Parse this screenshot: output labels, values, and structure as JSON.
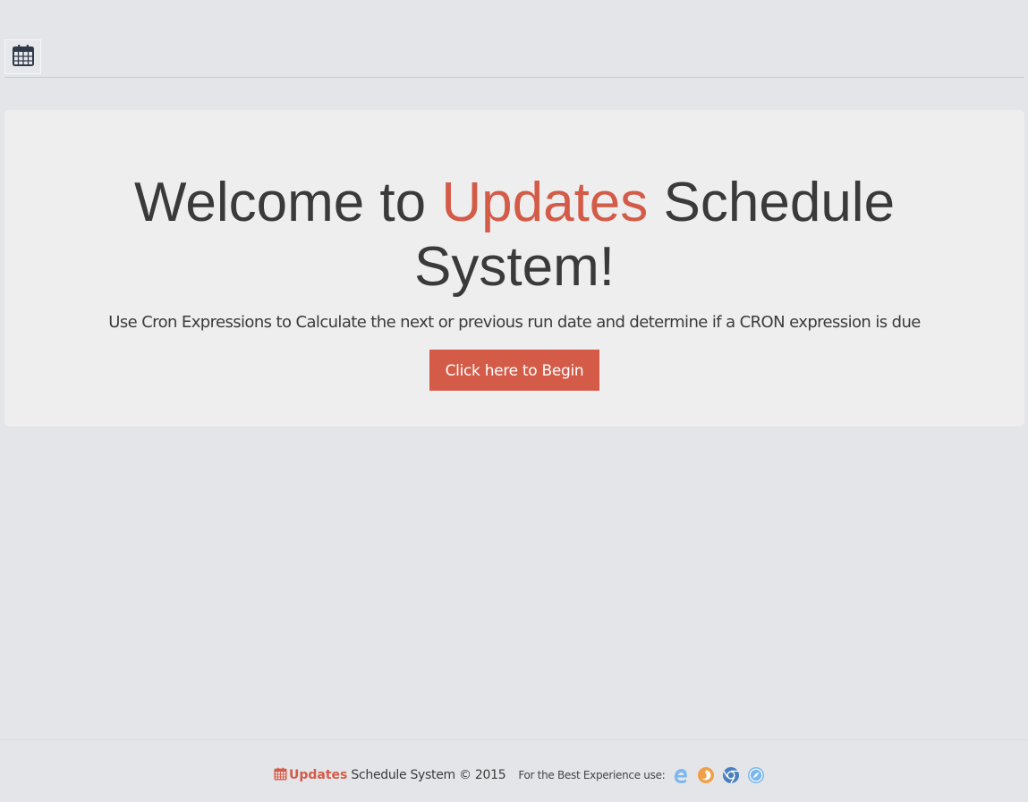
{
  "topbar": {
    "menu_icon": "calendar-icon"
  },
  "hero": {
    "title_part1": "Welcome to ",
    "title_accent": "Updates",
    "title_part2": " Schedule System!",
    "subtitle": "Use Cron Expressions to Calculate the next or previous run date and determine if a CRON expression is due",
    "button_label": "Click here to Begin"
  },
  "footer": {
    "brand_icon": "calendar-icon",
    "brand": "Updates",
    "rest": "Schedule System © 2015",
    "best_experience": "For the Best Experience use:",
    "browsers": [
      "edge-icon",
      "firefox-icon",
      "chrome-icon",
      "safari-icon"
    ]
  },
  "colors": {
    "accent": "#d35b48",
    "background": "#e4e5e9",
    "panel": "#eeeeee",
    "text": "#3a3a3a"
  }
}
